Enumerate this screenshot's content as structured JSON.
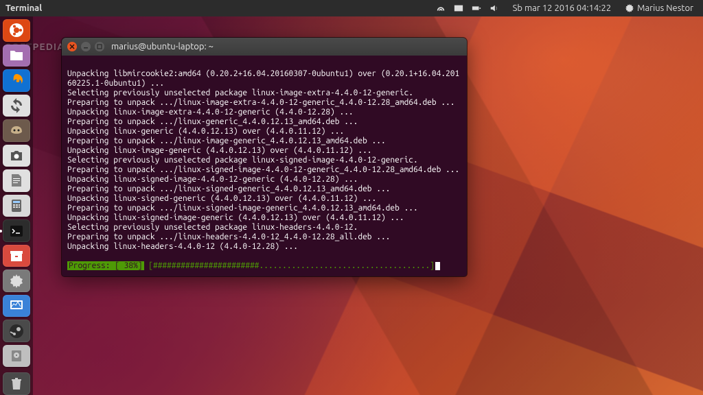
{
  "menubar": {
    "app_name": "Terminal",
    "clock": "Sb mar 12 2016   04:14:22",
    "user": "Marius Nestor"
  },
  "watermark": "SOFTPEDIA",
  "launcher": {
    "items": [
      {
        "name": "Dash",
        "bg": "#dd4814",
        "icon": "ubuntu"
      },
      {
        "name": "Files",
        "bg": "#a46eb0",
        "icon": "folder"
      },
      {
        "name": "Firefox",
        "bg": "#1071d3",
        "icon": "firefox"
      },
      {
        "name": "Updater",
        "bg": "#e0e0e0",
        "icon": "sync"
      },
      {
        "name": "GIMP",
        "bg": "#6d5a4c",
        "icon": "gimp"
      },
      {
        "name": "Screenshot",
        "bg": "#e0e0e0",
        "icon": "camera"
      },
      {
        "name": "TextEditor",
        "bg": "#e0e0e0",
        "icon": "note"
      },
      {
        "name": "Calculator",
        "bg": "#d9d9d9",
        "icon": "calc"
      },
      {
        "name": "Terminal",
        "bg": "#2c2c2c",
        "icon": "terminal",
        "running": true
      },
      {
        "name": "Archive",
        "bg": "#d94a3e",
        "icon": "archive"
      },
      {
        "name": "Settings",
        "bg": "#7a7a7a",
        "icon": "gear"
      },
      {
        "name": "Monitor",
        "bg": "#3a82d8",
        "icon": "monitor"
      },
      {
        "name": "Steam",
        "bg": "#4a4a4a",
        "icon": "steam"
      },
      {
        "name": "Disks",
        "bg": "#bfbfbf",
        "icon": "disk"
      }
    ],
    "trash": {
      "name": "Trash",
      "bg": "#4a4a4a",
      "icon": "trash"
    }
  },
  "terminal": {
    "title": "marius@ubuntu-laptop: ~",
    "lines": [
      "Unpacking libmircookie2:amd64 (0.20.2+16.04.20160307-0ubuntu1) over (0.20.1+16.04.20160225.1-0ubuntu1) ...",
      "Selecting previously unselected package linux-image-extra-4.4.0-12-generic.",
      "Preparing to unpack .../linux-image-extra-4.4.0-12-generic_4.4.0-12.28_amd64.deb ...",
      "Unpacking linux-image-extra-4.4.0-12-generic (4.4.0-12.28) ...",
      "Preparing to unpack .../linux-generic_4.4.0.12.13_amd64.deb ...",
      "Unpacking linux-generic (4.4.0.12.13) over (4.4.0.11.12) ...",
      "Preparing to unpack .../linux-image-generic_4.4.0.12.13_amd64.deb ...",
      "Unpacking linux-image-generic (4.4.0.12.13) over (4.4.0.11.12) ...",
      "Selecting previously unselected package linux-signed-image-4.4.0-12-generic.",
      "Preparing to unpack .../linux-signed-image-4.4.0-12-generic_4.4.0-12.28_amd64.deb ...",
      "Unpacking linux-signed-image-4.4.0-12-generic (4.4.0-12.28) ...",
      "Preparing to unpack .../linux-signed-generic_4.4.0.12.13_amd64.deb ...",
      "Unpacking linux-signed-generic (4.4.0.12.13) over (4.4.0.11.12) ...",
      "Preparing to unpack .../linux-signed-image-generic_4.4.0.12.13_amd64.deb ...",
      "Unpacking linux-signed-image-generic (4.4.0.12.13) over (4.4.0.11.12) ...",
      "Selecting previously unselected package linux-headers-4.4.0-12.",
      "Preparing to unpack .../linux-headers-4.4.0-12_4.4.0-12.28_all.deb ...",
      "Unpacking linux-headers-4.4.0-12 (4.4.0-12.28) ..."
    ],
    "progress": {
      "label": "Progress: [ 38%]",
      "bar": "[#######################.....................................]"
    }
  }
}
